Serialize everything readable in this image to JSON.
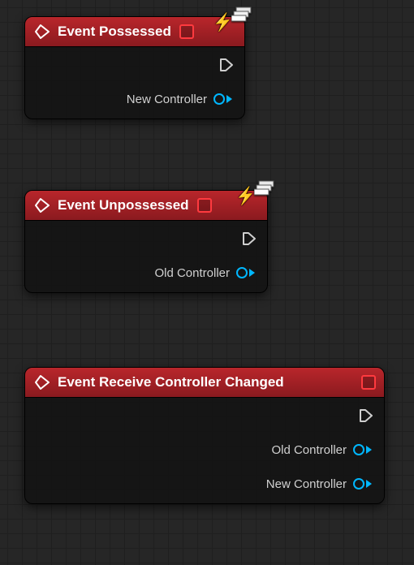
{
  "accent": "#b9262b",
  "pin_color": "#00b7ff",
  "nodes": {
    "possessed": {
      "title": "Event Possessed",
      "pins": {
        "exec": "",
        "p0": "New Controller"
      }
    },
    "unpossessed": {
      "title": "Event Unpossessed",
      "pins": {
        "exec": "",
        "p0": "Old Controller"
      }
    },
    "ctrlchanged": {
      "title": "Event Receive Controller Changed",
      "pins": {
        "exec": "",
        "p0": "Old Controller",
        "p1": "New Controller"
      }
    }
  }
}
